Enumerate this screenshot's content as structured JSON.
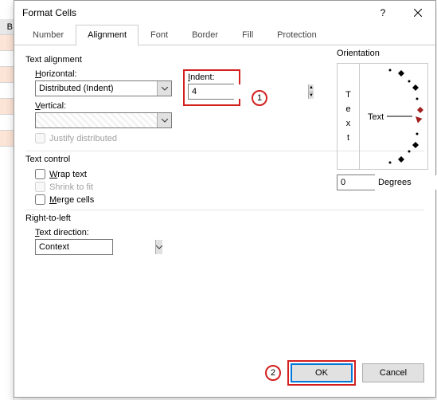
{
  "bg_cells": [
    "B",
    "",
    "",
    "",
    "",
    "",
    ""
  ],
  "dialog": {
    "title": "Format Cells",
    "tabs": [
      "Number",
      "Alignment",
      "Font",
      "Border",
      "Fill",
      "Protection"
    ],
    "active_tab": 1
  },
  "text_alignment": {
    "title": "Text alignment",
    "horizontal_label": "Horizontal:",
    "horizontal_value": "Distributed (Indent)",
    "vertical_label": "Vertical:",
    "vertical_value": "",
    "indent_label": "Indent:",
    "indent_value": "4",
    "justify_distributed": "Justify distributed"
  },
  "text_control": {
    "title": "Text control",
    "wrap": "Wrap text",
    "shrink": "Shrink to fit",
    "merge": "Merge cells"
  },
  "rtl": {
    "title": "Right-to-left",
    "direction_label": "Text direction:",
    "direction_value": "Context"
  },
  "orientation": {
    "title": "Orientation",
    "vert_text": [
      "T",
      "e",
      "x",
      "t"
    ],
    "dial_text": "Text",
    "degrees_value": "0",
    "degrees_label": "Degrees"
  },
  "buttons": {
    "ok": "OK",
    "cancel": "Cancel"
  },
  "markers": {
    "one": "1",
    "two": "2"
  }
}
